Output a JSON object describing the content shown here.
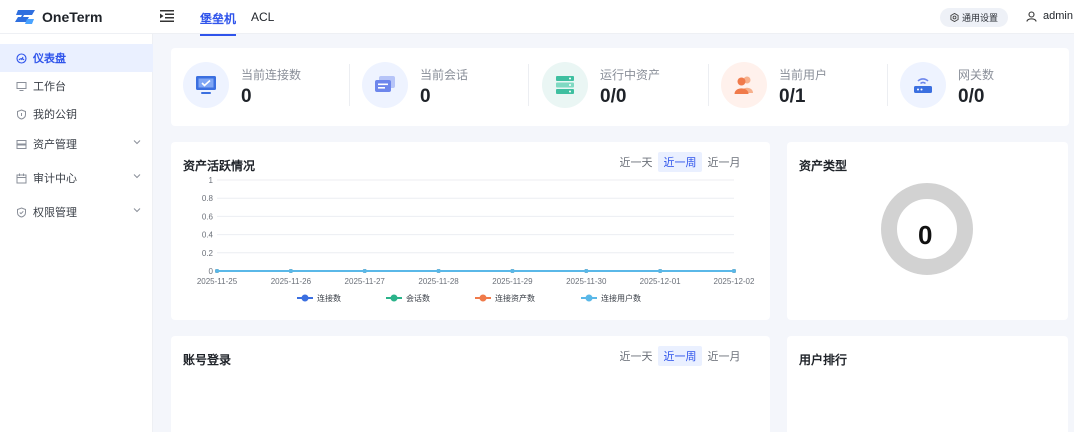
{
  "app": {
    "name": "OneTerm"
  },
  "top_nav": [
    {
      "label": "堡垒机",
      "active": true
    },
    {
      "label": "ACL",
      "active": false
    }
  ],
  "header": {
    "settings_label": "通用设置",
    "user_name": "admin"
  },
  "sidebar": {
    "items": [
      {
        "label": "仪表盘",
        "icon": "dashboard-icon",
        "active": true,
        "expandable": false
      },
      {
        "label": "工作台",
        "icon": "monitor-icon",
        "active": false,
        "expandable": false
      },
      {
        "label": "我的公钥",
        "icon": "shield-key-icon",
        "active": false,
        "expandable": false
      },
      {
        "label": "资产管理",
        "icon": "server-icon",
        "active": false,
        "expandable": true
      },
      {
        "label": "审计中心",
        "icon": "calendar-icon",
        "active": false,
        "expandable": true
      },
      {
        "label": "权限管理",
        "icon": "shield-check-icon",
        "active": false,
        "expandable": true
      }
    ]
  },
  "stats": [
    {
      "label": "当前连接数",
      "value": "0",
      "icon": "monitor-icon"
    },
    {
      "label": "当前会话",
      "value": "0",
      "icon": "chat-icon"
    },
    {
      "label": "运行中资产",
      "value": "0/0",
      "icon": "server-icon"
    },
    {
      "label": "当前用户",
      "value": "0/1",
      "icon": "users-icon"
    },
    {
      "label": "网关数",
      "value": "0/0",
      "icon": "gateway-icon"
    }
  ],
  "asset_activity": {
    "title": "资产活跃情况",
    "ranges": [
      "近一天",
      "近一周",
      "近一月"
    ],
    "active_range": 1
  },
  "asset_type": {
    "title": "资产类型",
    "total": "0"
  },
  "account_login": {
    "title": "账号登录",
    "ranges": [
      "近一天",
      "近一周",
      "近一月"
    ],
    "active_range": 1
  },
  "user_ranking": {
    "title": "用户排行"
  },
  "chart_data": {
    "type": "line",
    "categories": [
      "2025-11-25",
      "2025-11-26",
      "2025-11-27",
      "2025-11-28",
      "2025-11-29",
      "2025-11-30",
      "2025-12-01",
      "2025-12-02"
    ],
    "ylim": [
      0,
      1
    ],
    "yticks": [
      "0",
      "0.2",
      "0.4",
      "0.6",
      "0.8",
      "1"
    ],
    "grid": true,
    "legend_position": "bottom",
    "series": [
      {
        "name": "连接数",
        "color": "#3b6fe0",
        "values": [
          0,
          0,
          0,
          0,
          0,
          0,
          0,
          0
        ]
      },
      {
        "name": "会话数",
        "color": "#2bb38a",
        "values": [
          0,
          0,
          0,
          0,
          0,
          0,
          0,
          0
        ]
      },
      {
        "name": "连接资产数",
        "color": "#f07a4a",
        "values": [
          0,
          0,
          0,
          0,
          0,
          0,
          0,
          0
        ]
      },
      {
        "name": "连接用户数",
        "color": "#5ab8e8",
        "values": [
          0,
          0,
          0,
          0,
          0,
          0,
          0,
          0
        ]
      }
    ]
  }
}
